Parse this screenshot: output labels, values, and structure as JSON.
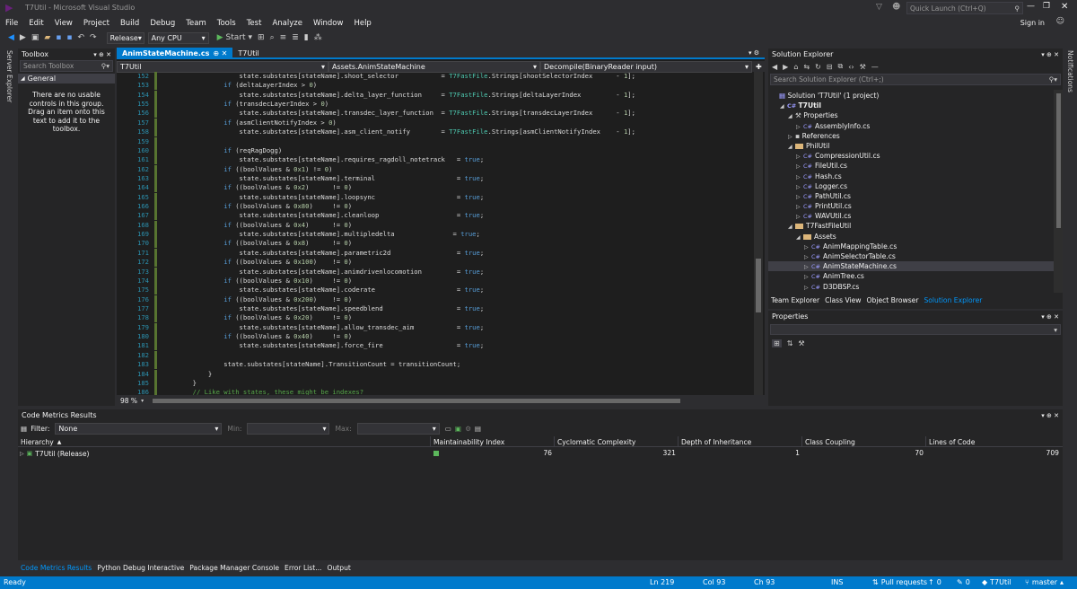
{
  "window": {
    "title": "T7Util - Microsoft Visual Studio",
    "quick_launch_placeholder": "Quick Launch (Ctrl+Q)",
    "sign_in": "Sign in"
  },
  "menu": [
    "File",
    "Edit",
    "View",
    "Project",
    "Build",
    "Debug",
    "Team",
    "Tools",
    "Test",
    "Analyze",
    "Window",
    "Help"
  ],
  "toolbar": {
    "configuration": "Release",
    "platform": "Any CPU",
    "start_label": "Start"
  },
  "side_tabs": {
    "left": "Server Explorer",
    "right": "Notifications"
  },
  "toolbox": {
    "title": "Toolbox",
    "search_placeholder": "Search Toolbox",
    "section": "General",
    "empty_message": "There are no usable controls in this group. Drag an item onto this text to add it to the toolbox."
  },
  "editor": {
    "tabs": [
      {
        "label": "AnimStateMachine.cs"
      },
      {
        "label": "T7Util"
      }
    ],
    "nav": {
      "project": "T7Util",
      "class": "Assets.AnimStateMachine",
      "member": "Decompile(BinaryReader input)"
    },
    "zoom": "98 %",
    "lines": [
      {
        "n": "152",
        "t": "                    state.substates[stateName].shoot_selector           = T7FastFile.Strings[shootSelectorIndex      - 1];"
      },
      {
        "n": "153",
        "t": "                if (deltaLayerIndex > 0)"
      },
      {
        "n": "154",
        "t": "                    state.substates[stateName].delta_layer_function     = T7FastFile.Strings[deltaLayerIndex         - 1];"
      },
      {
        "n": "155",
        "t": "                if (transdecLayerIndex > 0)"
      },
      {
        "n": "156",
        "t": "                    state.substates[stateName].transdec_layer_function  = T7FastFile.Strings[transdecLayerIndex      - 1];"
      },
      {
        "n": "157",
        "t": "                if (asmClientNotifyIndex > 0)"
      },
      {
        "n": "158",
        "t": "                    state.substates[stateName].asm_client_notify        = T7FastFile.Strings[asmClientNotifyIndex    - 1];"
      },
      {
        "n": "159",
        "t": ""
      },
      {
        "n": "160",
        "t": "                if (reqRagDogg)"
      },
      {
        "n": "161",
        "t": "                    state.substates[stateName].requires_ragdoll_notetrack   = true;"
      },
      {
        "n": "162",
        "t": "                if ((boolValues & 0x1) != 0)"
      },
      {
        "n": "163",
        "t": "                    state.substates[stateName].terminal                     = true;"
      },
      {
        "n": "164",
        "t": "                if ((boolValues & 0x2)      != 0)"
      },
      {
        "n": "165",
        "t": "                    state.substates[stateName].loopsync                     = true;"
      },
      {
        "n": "166",
        "t": "                if ((boolValues & 0x80)     != 0)"
      },
      {
        "n": "167",
        "t": "                    state.substates[stateName].cleanloop                    = true;"
      },
      {
        "n": "168",
        "t": "                if ((boolValues & 0x4)      != 0)"
      },
      {
        "n": "169",
        "t": "                    state.substates[stateName].multipledelta               = true;"
      },
      {
        "n": "170",
        "t": "                if ((boolValues & 0x8)      != 0)"
      },
      {
        "n": "171",
        "t": "                    state.substates[stateName].parametric2d                 = true;"
      },
      {
        "n": "172",
        "t": "                if ((boolValues & 0x100)    != 0)"
      },
      {
        "n": "173",
        "t": "                    state.substates[stateName].animdrivenlocomotion         = true;"
      },
      {
        "n": "174",
        "t": "                if ((boolValues & 0x10)     != 0)"
      },
      {
        "n": "175",
        "t": "                    state.substates[stateName].coderate                     = true;"
      },
      {
        "n": "176",
        "t": "                if ((boolValues & 0x200)    != 0)"
      },
      {
        "n": "177",
        "t": "                    state.substates[stateName].speedblend                   = true;"
      },
      {
        "n": "178",
        "t": "                if ((boolValues & 0x20)     != 0)"
      },
      {
        "n": "179",
        "t": "                    state.substates[stateName].allow_transdec_aim           = true;"
      },
      {
        "n": "180",
        "t": "                if ((boolValues & 0x40)     != 0)"
      },
      {
        "n": "181",
        "t": "                    state.substates[stateName].force_fire                   = true;"
      },
      {
        "n": "182",
        "t": ""
      },
      {
        "n": "183",
        "t": "                state.substates[stateName].TransitionCount = transitionCount;"
      },
      {
        "n": "184",
        "t": "            }"
      },
      {
        "n": "185",
        "t": "        }"
      },
      {
        "n": "186",
        "t": "        // Like with states, these might be indexes?"
      },
      {
        "n": "187",
        "t": "        input.Seek(totalTransitions * 4, SeekOrigin.Current);"
      }
    ]
  },
  "solution_explorer": {
    "title": "Solution Explorer",
    "search_placeholder": "Search Solution Explorer (Ctrl+;)",
    "items": [
      {
        "label": "Solution 'T7Util' (1 project)",
        "depth": 0,
        "kind": "solution"
      },
      {
        "label": "T7Util",
        "depth": 1,
        "kind": "project"
      },
      {
        "label": "Properties",
        "depth": 2,
        "kind": "props"
      },
      {
        "label": "AssemblyInfo.cs",
        "depth": 3,
        "kind": "cs"
      },
      {
        "label": "References",
        "depth": 2,
        "kind": "refs"
      },
      {
        "label": "PhilUtil",
        "depth": 2,
        "kind": "folder"
      },
      {
        "label": "CompressionUtil.cs",
        "depth": 3,
        "kind": "cs"
      },
      {
        "label": "FileUtil.cs",
        "depth": 3,
        "kind": "cs"
      },
      {
        "label": "Hash.cs",
        "depth": 3,
        "kind": "cs"
      },
      {
        "label": "Logger.cs",
        "depth": 3,
        "kind": "cs"
      },
      {
        "label": "PathUtil.cs",
        "depth": 3,
        "kind": "cs"
      },
      {
        "label": "PrintUtil.cs",
        "depth": 3,
        "kind": "cs"
      },
      {
        "label": "WAVUtil.cs",
        "depth": 3,
        "kind": "cs"
      },
      {
        "label": "T7FastFileUtil",
        "depth": 2,
        "kind": "folder"
      },
      {
        "label": "Assets",
        "depth": 3,
        "kind": "folder"
      },
      {
        "label": "AnimMappingTable.cs",
        "depth": 4,
        "kind": "cs"
      },
      {
        "label": "AnimSelectorTable.cs",
        "depth": 4,
        "kind": "cs"
      },
      {
        "label": "AnimStateMachine.cs",
        "depth": 4,
        "kind": "cs",
        "selected": true
      },
      {
        "label": "AnimTree.cs",
        "depth": 4,
        "kind": "cs"
      },
      {
        "label": "D3DBSP.cs",
        "depth": 4,
        "kind": "cs"
      }
    ],
    "bottom_tabs": [
      "Team Explorer",
      "Class View",
      "Object Browser",
      "Solution Explorer"
    ]
  },
  "properties": {
    "title": "Properties"
  },
  "code_metrics": {
    "title": "Code Metrics Results",
    "filter_label": "Filter:",
    "filter_value": "None",
    "min_label": "Min:",
    "max_label": "Max:",
    "columns": [
      "Hierarchy",
      "Maintainability Index",
      "Cyclomatic Complexity",
      "Depth of Inheritance",
      "Class Coupling",
      "Lines of Code"
    ],
    "row": {
      "name": "T7Util (Release)",
      "maintainability": "76",
      "cyclomatic": "321",
      "depth": "1",
      "coupling": "70",
      "loc": "709"
    },
    "bottom_tabs": [
      "Code Metrics Results",
      "Python Debug Interactive",
      "Package Manager Console",
      "Error List...",
      "Output"
    ]
  },
  "status": {
    "ready": "Ready",
    "ln": "Ln 219",
    "col": "Col 93",
    "ch": "Ch 93",
    "ins": "INS",
    "pull": "Pull requests",
    "up": "0",
    "pencil": "0",
    "repo": "T7Util",
    "branch": "master"
  },
  "colors": {
    "accent": "#007acc",
    "bg": "#2d2d30",
    "editor": "#1e1e1e",
    "selection": "#3f3f46"
  }
}
